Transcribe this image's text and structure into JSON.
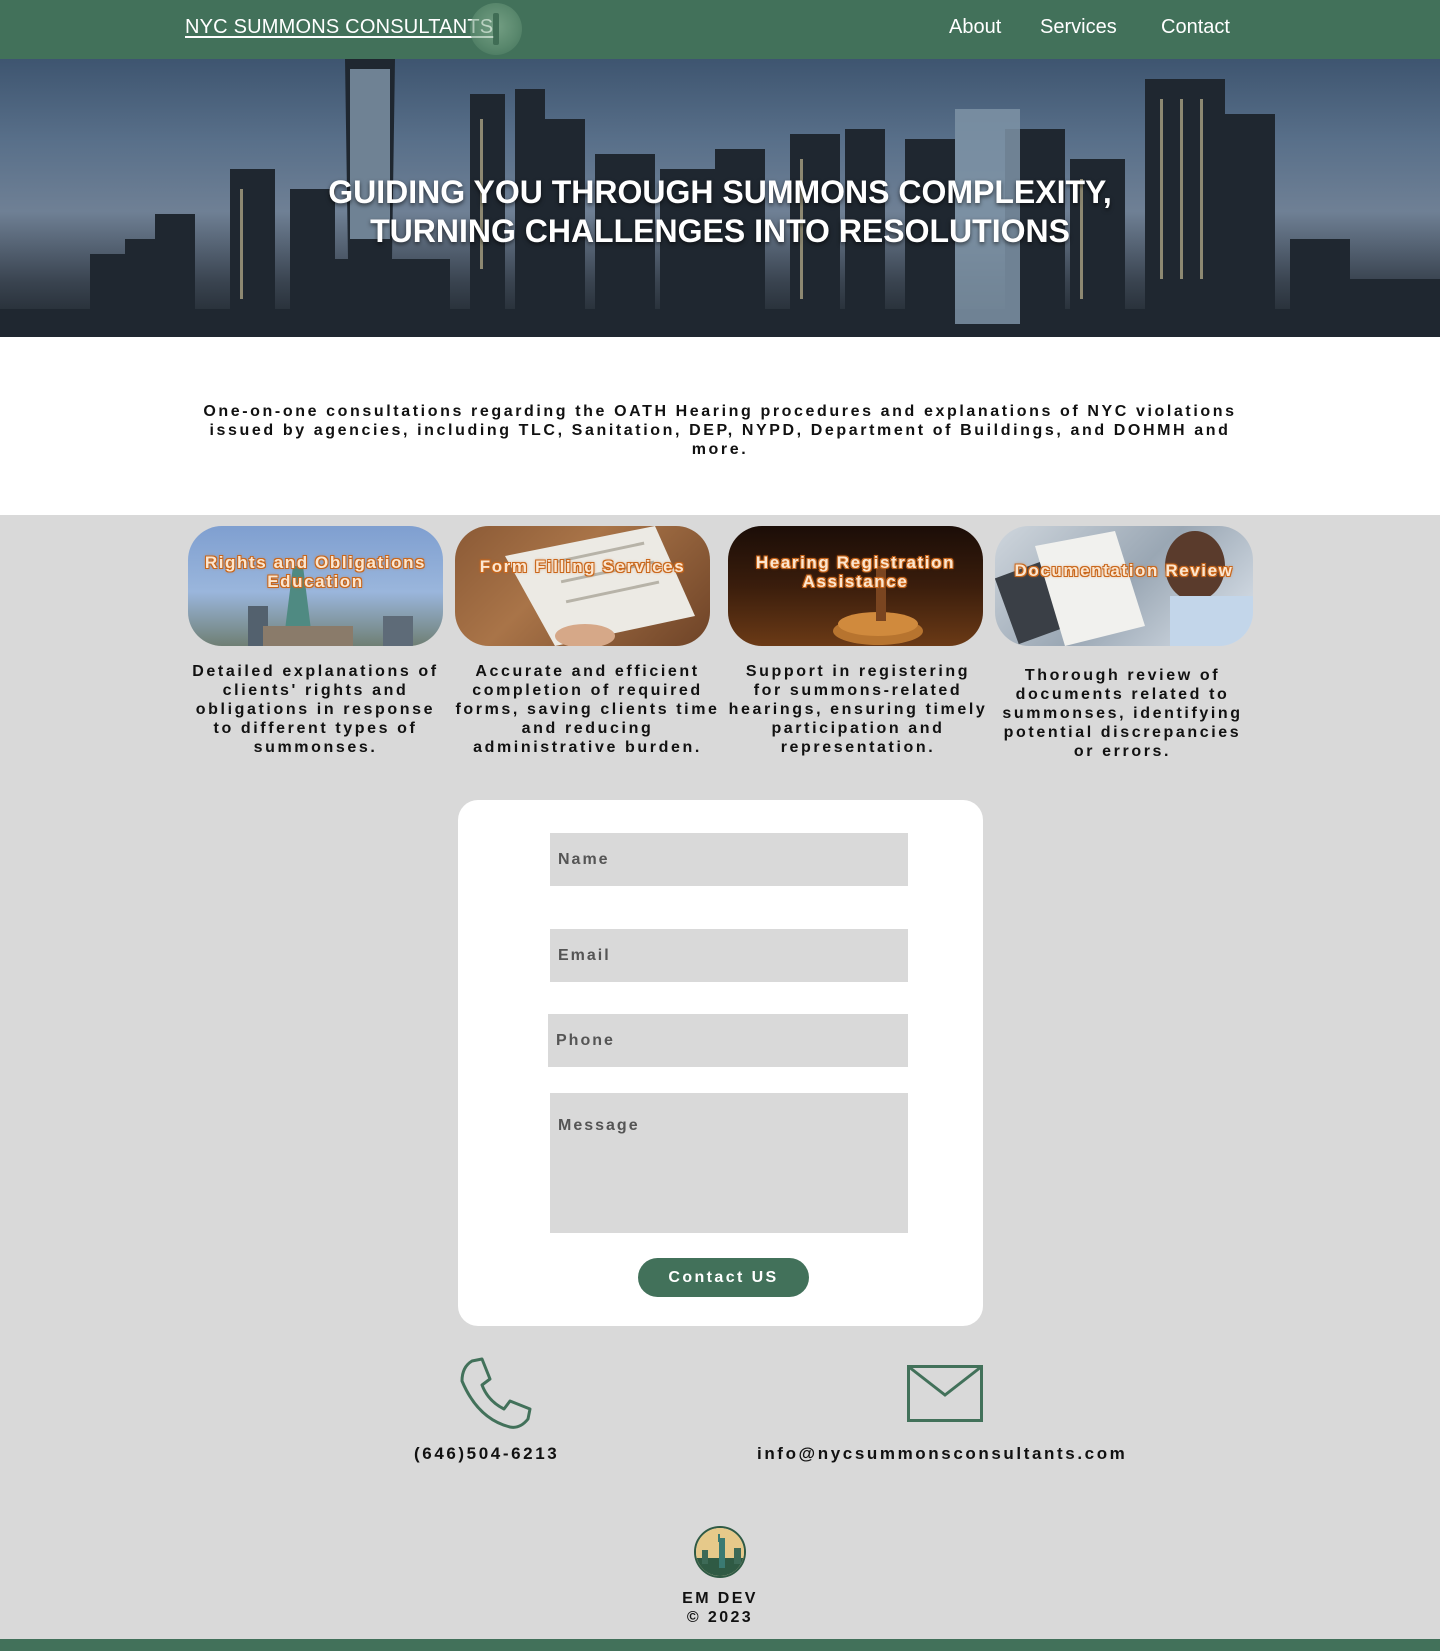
{
  "header": {
    "brand": "NYC SUMMONS CONSULTANTS",
    "nav": [
      "About",
      "Services",
      "Contact"
    ]
  },
  "hero": {
    "title_line1": "GUIDING YOU THROUGH SUMMONS COMPLEXITY,",
    "title_line2": "TURNING CHALLENGES INTO RESOLUTIONS"
  },
  "intro": {
    "text": "One-on-one consultations regarding the OATH Hearing procedures and explanations of NYC violations issued by agencies, including TLC, Sanitation, DEP, NYPD, Department of Buildings, and DOHMH and more."
  },
  "services": [
    {
      "title": "Rights and Obligations Education",
      "description": "Detailed explanations of clients' rights and obligations in response to different types of summonses."
    },
    {
      "title": "Form Filling Services",
      "description": "Accurate and efficient completion of required forms, saving clients time and reducing administrative burden."
    },
    {
      "title": "Hearing Registration Assistance",
      "description": "Support in registering for summons-related hearings, ensuring timely participation and representation."
    },
    {
      "title": "Documentation Review",
      "description": "Thorough review of documents related to summonses, identifying potential discrepancies or errors."
    }
  ],
  "form": {
    "name_placeholder": "Name",
    "email_placeholder": "Email",
    "phone_placeholder": "Phone",
    "message_placeholder": "Message",
    "submit_label": "Contact US"
  },
  "contact": {
    "phone": "(646)504-6213",
    "email": "info@nycsummonsconsultants.com",
    "phone_icon": "phone-icon",
    "email_icon": "envelope-icon"
  },
  "footer": {
    "line1": "EM DEV",
    "line2": "© 2023"
  },
  "colors": {
    "brand_green": "#42715a",
    "accent_orange": "#c9661a",
    "page_gray": "#d9d9d9"
  }
}
